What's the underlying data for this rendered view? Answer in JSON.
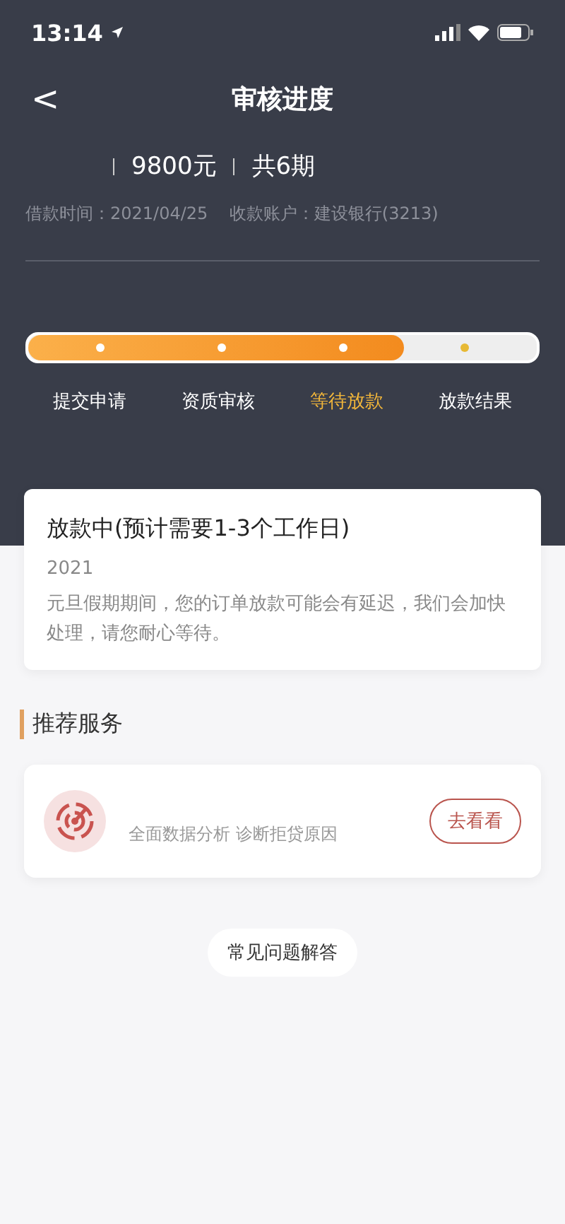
{
  "status_bar": {
    "time": "13:14"
  },
  "header": {
    "back": "<",
    "title": "审核进度"
  },
  "loan": {
    "amount": "9800元",
    "periods": "共6期",
    "info": "借款时间：2021/04/25    收款账户：建设银行(3213)"
  },
  "progress": {
    "level": 0.74,
    "steps": [
      {
        "label": "提交申请",
        "done": true,
        "selected": false
      },
      {
        "label": "资质审核",
        "done": true,
        "selected": false
      },
      {
        "label": "等待放款",
        "done": true,
        "selected": true
      },
      {
        "label": "放款结果",
        "done": false,
        "selected": false
      }
    ]
  },
  "notice": {
    "title": "放款中(预计需要1-3个工作日)",
    "date": "2021",
    "body": "元旦假期期间，您的订单放款可能会有延迟，我们会加快处理，请您耐心等待。"
  },
  "recommend": {
    "title": "推荐服务",
    "service": {
      "description": "全面数据分析 诊断拒贷原因",
      "button": "去看看"
    }
  },
  "faq": "常见问题解答"
}
